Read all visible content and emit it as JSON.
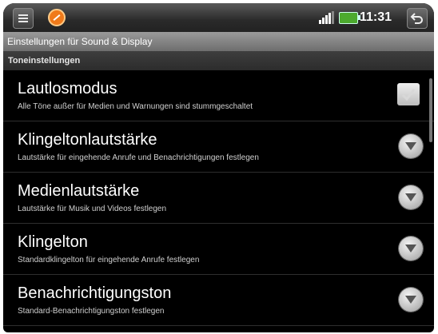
{
  "status_bar": {
    "time": "11:31"
  },
  "title_bar": {
    "title": "Einstellungen für Sound & Display"
  },
  "section": {
    "header": "Toneinstellungen"
  },
  "settings": [
    {
      "title": "Lautlosmodus",
      "subtitle": "Alle Töne außer für Medien und Warnungen sind stummgeschaltet",
      "control": "checkbox",
      "checked": false
    },
    {
      "title": "Klingeltonlautstärke",
      "subtitle": "Lautstärke für eingehende Anrufe und Benachrichtigungen festlegen",
      "control": "dropdown"
    },
    {
      "title": "Medienlautstärke",
      "subtitle": "Lautstärke für Musik und Videos festlegen",
      "control": "dropdown"
    },
    {
      "title": "Klingelton",
      "subtitle": "Standardklingelton für eingehende Anrufe festlegen",
      "control": "dropdown"
    },
    {
      "title": "Benachrichtigungston",
      "subtitle": "Standard-Benachrichtigungston festlegen",
      "control": "dropdown"
    }
  ]
}
